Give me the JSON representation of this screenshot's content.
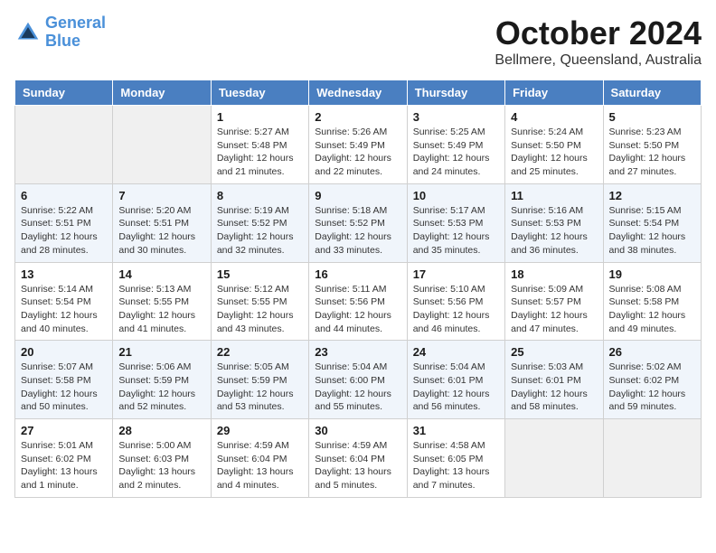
{
  "header": {
    "logo_line1": "General",
    "logo_line2": "Blue",
    "month": "October 2024",
    "location": "Bellmere, Queensland, Australia"
  },
  "weekdays": [
    "Sunday",
    "Monday",
    "Tuesday",
    "Wednesday",
    "Thursday",
    "Friday",
    "Saturday"
  ],
  "weeks": [
    [
      {
        "day": "",
        "info": ""
      },
      {
        "day": "",
        "info": ""
      },
      {
        "day": "1",
        "info": "Sunrise: 5:27 AM\nSunset: 5:48 PM\nDaylight: 12 hours and 21 minutes."
      },
      {
        "day": "2",
        "info": "Sunrise: 5:26 AM\nSunset: 5:49 PM\nDaylight: 12 hours and 22 minutes."
      },
      {
        "day": "3",
        "info": "Sunrise: 5:25 AM\nSunset: 5:49 PM\nDaylight: 12 hours and 24 minutes."
      },
      {
        "day": "4",
        "info": "Sunrise: 5:24 AM\nSunset: 5:50 PM\nDaylight: 12 hours and 25 minutes."
      },
      {
        "day": "5",
        "info": "Sunrise: 5:23 AM\nSunset: 5:50 PM\nDaylight: 12 hours and 27 minutes."
      }
    ],
    [
      {
        "day": "6",
        "info": "Sunrise: 5:22 AM\nSunset: 5:51 PM\nDaylight: 12 hours and 28 minutes."
      },
      {
        "day": "7",
        "info": "Sunrise: 5:20 AM\nSunset: 5:51 PM\nDaylight: 12 hours and 30 minutes."
      },
      {
        "day": "8",
        "info": "Sunrise: 5:19 AM\nSunset: 5:52 PM\nDaylight: 12 hours and 32 minutes."
      },
      {
        "day": "9",
        "info": "Sunrise: 5:18 AM\nSunset: 5:52 PM\nDaylight: 12 hours and 33 minutes."
      },
      {
        "day": "10",
        "info": "Sunrise: 5:17 AM\nSunset: 5:53 PM\nDaylight: 12 hours and 35 minutes."
      },
      {
        "day": "11",
        "info": "Sunrise: 5:16 AM\nSunset: 5:53 PM\nDaylight: 12 hours and 36 minutes."
      },
      {
        "day": "12",
        "info": "Sunrise: 5:15 AM\nSunset: 5:54 PM\nDaylight: 12 hours and 38 minutes."
      }
    ],
    [
      {
        "day": "13",
        "info": "Sunrise: 5:14 AM\nSunset: 5:54 PM\nDaylight: 12 hours and 40 minutes."
      },
      {
        "day": "14",
        "info": "Sunrise: 5:13 AM\nSunset: 5:55 PM\nDaylight: 12 hours and 41 minutes."
      },
      {
        "day": "15",
        "info": "Sunrise: 5:12 AM\nSunset: 5:55 PM\nDaylight: 12 hours and 43 minutes."
      },
      {
        "day": "16",
        "info": "Sunrise: 5:11 AM\nSunset: 5:56 PM\nDaylight: 12 hours and 44 minutes."
      },
      {
        "day": "17",
        "info": "Sunrise: 5:10 AM\nSunset: 5:56 PM\nDaylight: 12 hours and 46 minutes."
      },
      {
        "day": "18",
        "info": "Sunrise: 5:09 AM\nSunset: 5:57 PM\nDaylight: 12 hours and 47 minutes."
      },
      {
        "day": "19",
        "info": "Sunrise: 5:08 AM\nSunset: 5:58 PM\nDaylight: 12 hours and 49 minutes."
      }
    ],
    [
      {
        "day": "20",
        "info": "Sunrise: 5:07 AM\nSunset: 5:58 PM\nDaylight: 12 hours and 50 minutes."
      },
      {
        "day": "21",
        "info": "Sunrise: 5:06 AM\nSunset: 5:59 PM\nDaylight: 12 hours and 52 minutes."
      },
      {
        "day": "22",
        "info": "Sunrise: 5:05 AM\nSunset: 5:59 PM\nDaylight: 12 hours and 53 minutes."
      },
      {
        "day": "23",
        "info": "Sunrise: 5:04 AM\nSunset: 6:00 PM\nDaylight: 12 hours and 55 minutes."
      },
      {
        "day": "24",
        "info": "Sunrise: 5:04 AM\nSunset: 6:01 PM\nDaylight: 12 hours and 56 minutes."
      },
      {
        "day": "25",
        "info": "Sunrise: 5:03 AM\nSunset: 6:01 PM\nDaylight: 12 hours and 58 minutes."
      },
      {
        "day": "26",
        "info": "Sunrise: 5:02 AM\nSunset: 6:02 PM\nDaylight: 12 hours and 59 minutes."
      }
    ],
    [
      {
        "day": "27",
        "info": "Sunrise: 5:01 AM\nSunset: 6:02 PM\nDaylight: 13 hours and 1 minute."
      },
      {
        "day": "28",
        "info": "Sunrise: 5:00 AM\nSunset: 6:03 PM\nDaylight: 13 hours and 2 minutes."
      },
      {
        "day": "29",
        "info": "Sunrise: 4:59 AM\nSunset: 6:04 PM\nDaylight: 13 hours and 4 minutes."
      },
      {
        "day": "30",
        "info": "Sunrise: 4:59 AM\nSunset: 6:04 PM\nDaylight: 13 hours and 5 minutes."
      },
      {
        "day": "31",
        "info": "Sunrise: 4:58 AM\nSunset: 6:05 PM\nDaylight: 13 hours and 7 minutes."
      },
      {
        "day": "",
        "info": ""
      },
      {
        "day": "",
        "info": ""
      }
    ]
  ]
}
